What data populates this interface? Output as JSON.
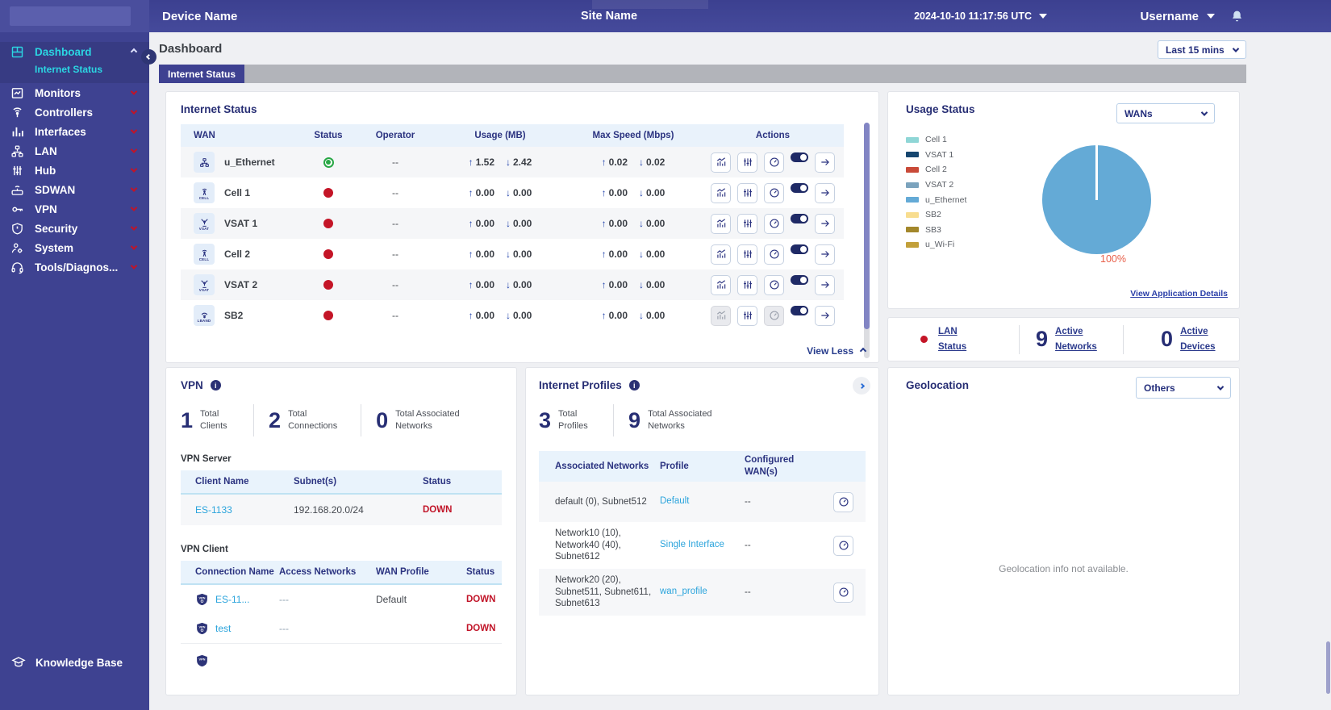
{
  "header": {
    "device_name": "Device Name",
    "site_name": "Site Name",
    "timestamp": "2024-10-10 11:17:56 UTC",
    "username": "Username"
  },
  "sidebar": {
    "items": [
      {
        "label": "Dashboard"
      },
      {
        "label": "Monitors"
      },
      {
        "label": "Controllers"
      },
      {
        "label": "Interfaces"
      },
      {
        "label": "LAN"
      },
      {
        "label": "Hub"
      },
      {
        "label": "SDWAN"
      },
      {
        "label": "VPN"
      },
      {
        "label": "Security"
      },
      {
        "label": "System"
      },
      {
        "label": "Tools/Diagnos..."
      }
    ],
    "sub_item": "Internet Status",
    "knowledge_base": "Knowledge Base"
  },
  "page": {
    "title": "Dashboard",
    "tab": "Internet Status",
    "time_range": "Last 15 mins"
  },
  "internet_status": {
    "title": "Internet Status",
    "columns": [
      "WAN",
      "Status",
      "Operator",
      "Usage (MB)",
      "Max Speed (Mbps)",
      "Actions"
    ],
    "rows": [
      {
        "name": "u_Ethernet",
        "badge": "",
        "status": "up",
        "operator": "--",
        "usage_up": "1.52",
        "usage_down": "2.42",
        "speed_up": "0.02",
        "speed_down": "0.02"
      },
      {
        "name": "Cell 1",
        "badge": "CELL",
        "status": "down",
        "operator": "--",
        "usage_up": "0.00",
        "usage_down": "0.00",
        "speed_up": "0.00",
        "speed_down": "0.00"
      },
      {
        "name": "VSAT 1",
        "badge": "VSAT",
        "status": "down",
        "operator": "--",
        "usage_up": "0.00",
        "usage_down": "0.00",
        "speed_up": "0.00",
        "speed_down": "0.00"
      },
      {
        "name": "Cell 2",
        "badge": "CELL",
        "status": "down",
        "operator": "--",
        "usage_up": "0.00",
        "usage_down": "0.00",
        "speed_up": "0.00",
        "speed_down": "0.00"
      },
      {
        "name": "VSAT 2",
        "badge": "VSAT",
        "status": "down",
        "operator": "--",
        "usage_up": "0.00",
        "usage_down": "0.00",
        "speed_up": "0.00",
        "speed_down": "0.00"
      },
      {
        "name": "SB2",
        "badge": "LBAND",
        "status": "down",
        "operator": "--",
        "usage_up": "0.00",
        "usage_down": "0.00",
        "speed_up": "0.00",
        "speed_down": "0.00"
      }
    ],
    "view_less": "View Less"
  },
  "usage_status": {
    "title": "Usage Status",
    "dropdown": "WANs",
    "legend": [
      {
        "label": "Cell 1",
        "color": "#8fd6d6"
      },
      {
        "label": "VSAT 1",
        "color": "#16466f"
      },
      {
        "label": "Cell 2",
        "color": "#c94a38"
      },
      {
        "label": "VSAT 2",
        "color": "#7ba3bd"
      },
      {
        "label": "u_Ethernet",
        "color": "#64aad6"
      },
      {
        "label": "SB2",
        "color": "#f8dd8f"
      },
      {
        "label": "SB3",
        "color": "#a3872b"
      },
      {
        "label": "u_Wi-Fi",
        "color": "#c2a03a"
      }
    ],
    "pie_color": "#64aad6",
    "pie_label": "100%",
    "link": "View Application Details"
  },
  "chart_data": {
    "type": "pie",
    "title": "Usage Status",
    "labels": [
      "Cell 1",
      "VSAT 1",
      "Cell 2",
      "VSAT 2",
      "u_Ethernet",
      "SB2",
      "SB3",
      "u_Wi-Fi"
    ],
    "values": [
      0,
      0,
      0,
      0,
      100,
      0,
      0,
      0
    ],
    "unit": "%",
    "annotation": "100%",
    "legend_position": "left"
  },
  "lan_summary": {
    "status_label": "LAN Status",
    "networks_count": "9",
    "networks_label": "Active Networks",
    "devices_count": "0",
    "devices_label": "Active Devices"
  },
  "vpn": {
    "title": "VPN",
    "stats": [
      {
        "count": "1",
        "label": "Total Clients"
      },
      {
        "count": "2",
        "label": "Total Connections"
      },
      {
        "count": "0",
        "label": "Total Associated Networks"
      }
    ],
    "server": {
      "label": "VPN Server",
      "columns": [
        "Client Name",
        "Subnet(s)",
        "Status"
      ],
      "rows": [
        {
          "client": "ES-1133",
          "subnets": "192.168.20.0/24",
          "status": "DOWN"
        }
      ]
    },
    "client": {
      "label": "VPN Client",
      "columns": [
        "Connection Name",
        "Access Networks",
        "WAN Profile",
        "Status"
      ],
      "rows": [
        {
          "name": "ES-11...",
          "access": "---",
          "profile": "Default",
          "status": "DOWN"
        },
        {
          "name": "test",
          "access": "---",
          "profile": "",
          "status": "DOWN"
        }
      ]
    }
  },
  "internet_profiles": {
    "title": "Internet Profiles",
    "stats": [
      {
        "count": "3",
        "label": "Total Profiles"
      },
      {
        "count": "9",
        "label": "Total Associated Networks"
      }
    ],
    "columns": [
      "Associated Networks",
      "Profile",
      "Configured WAN(s)"
    ],
    "rows": [
      {
        "networks": "default (0), Subnet512",
        "profile": "Default",
        "wans": "--"
      },
      {
        "networks": "Network10 (10), Network40 (40), Subnet612",
        "profile": "Single Interface",
        "wans": "--"
      },
      {
        "networks": "Network20 (20), Subnet511, Subnet611, Subnet613",
        "profile": "wan_profile",
        "wans": "--"
      }
    ]
  },
  "geolocation": {
    "title": "Geolocation",
    "dropdown": "Others",
    "empty_text": "Geolocation info not available."
  }
}
